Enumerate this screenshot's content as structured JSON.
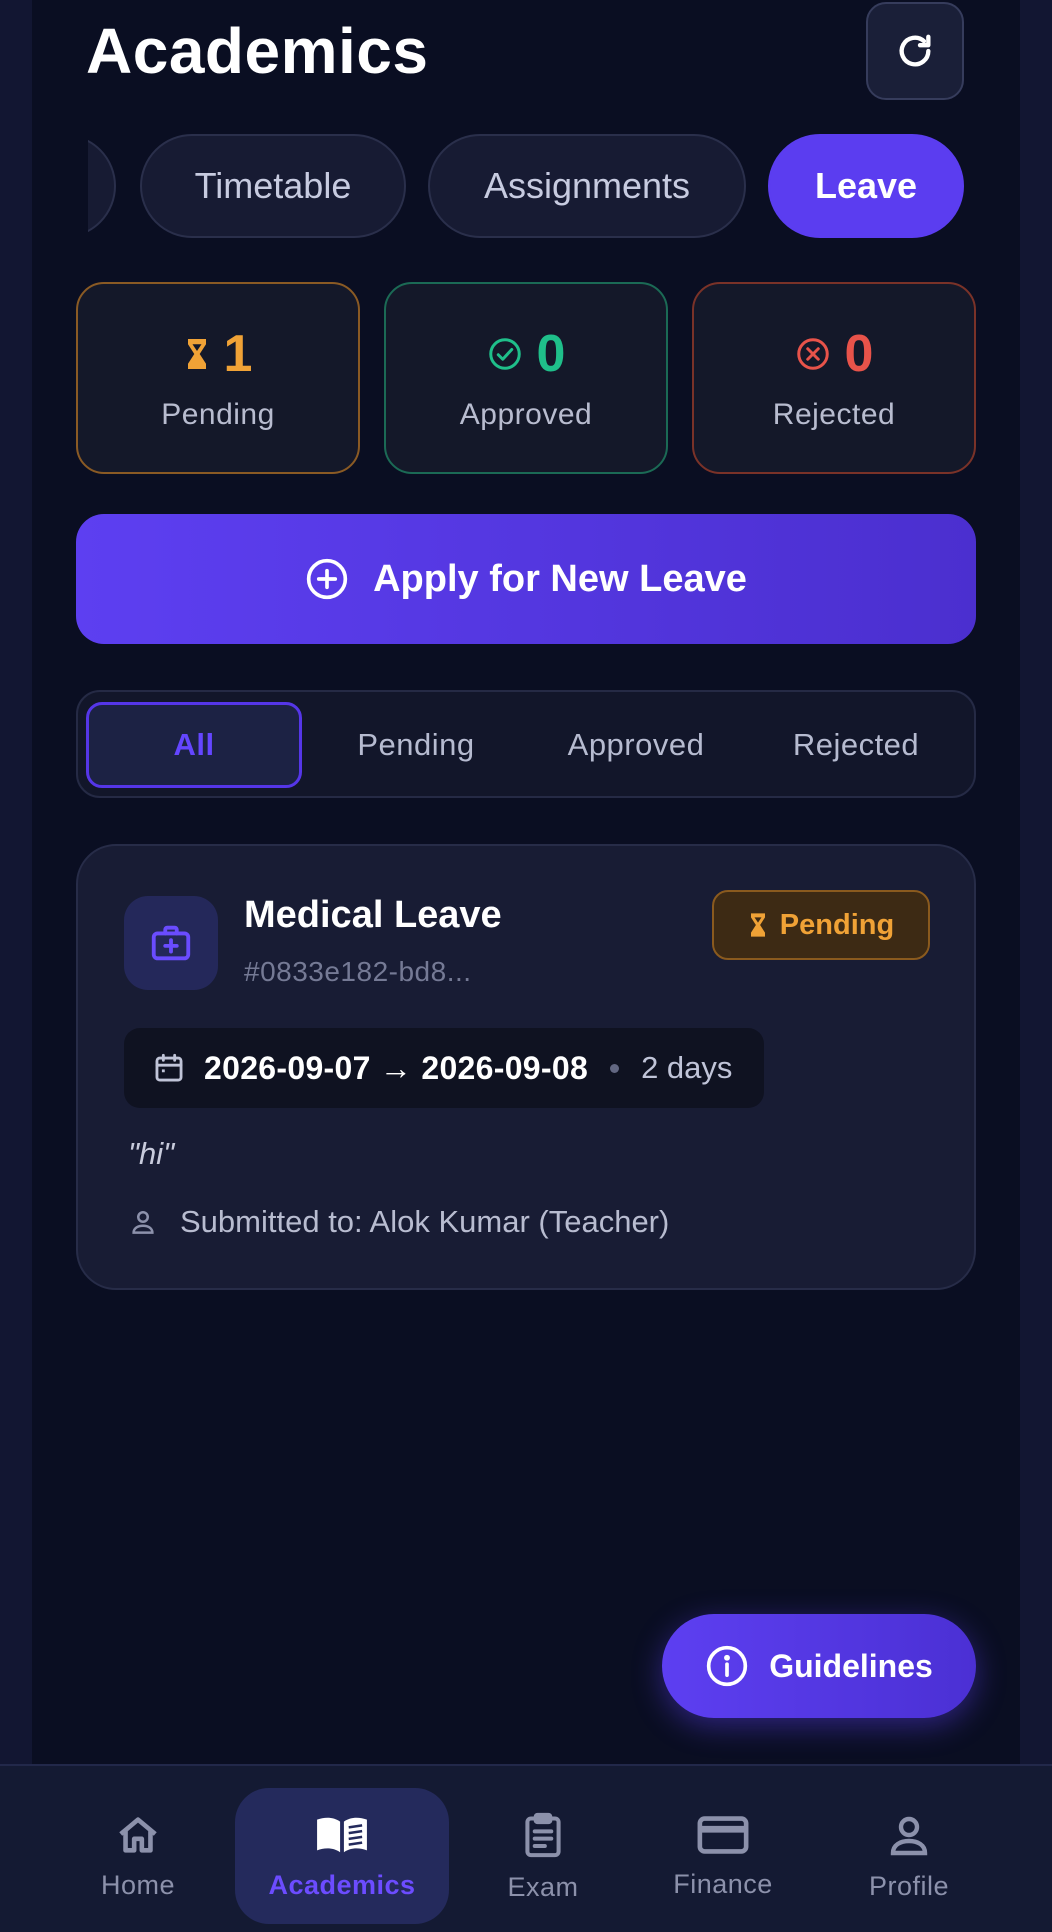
{
  "header": {
    "title": "Academics"
  },
  "tabs": [
    {
      "label": ""
    },
    {
      "label": "Timetable"
    },
    {
      "label": "Assignments"
    },
    {
      "label": "Leave"
    }
  ],
  "stats": {
    "pending": {
      "count": "1",
      "label": "Pending",
      "color": "#f0a236"
    },
    "approved": {
      "count": "0",
      "label": "Approved",
      "color": "#1fbf8a"
    },
    "rejected": {
      "count": "0",
      "label": "Rejected",
      "color": "#e8534a"
    }
  },
  "apply_button": {
    "label": "Apply for New Leave"
  },
  "filters": [
    {
      "label": "All"
    },
    {
      "label": "Pending"
    },
    {
      "label": "Approved"
    },
    {
      "label": "Rejected"
    }
  ],
  "leave_card": {
    "type": "Medical Leave",
    "id": "#0833e182-bd8...",
    "status": "Pending",
    "date_range": "2026-09-07 → 2026-09-08",
    "duration": "2 days",
    "reason": "\"hi\"",
    "submitted_to": "Submitted to: Alok Kumar (Teacher)"
  },
  "guidelines_button": {
    "label": "Guidelines"
  },
  "bottom_nav": [
    {
      "label": "Home",
      "icon": "home-icon"
    },
    {
      "label": "Academics",
      "icon": "book-icon"
    },
    {
      "label": "Exam",
      "icon": "clipboard-icon"
    },
    {
      "label": "Finance",
      "icon": "card-icon"
    },
    {
      "label": "Profile",
      "icon": "user-icon"
    }
  ],
  "colors": {
    "accent": "#5b3df0",
    "background": "#0a0e22",
    "card": "#181c34"
  }
}
